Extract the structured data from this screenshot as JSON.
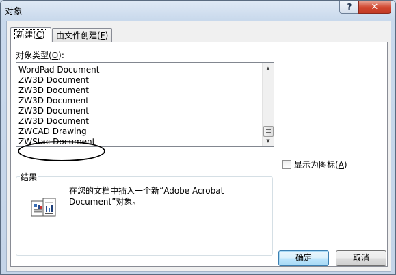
{
  "window": {
    "title": "对象",
    "help_label": "?",
    "close_label": "✕"
  },
  "tabs": [
    {
      "label": "新建(C)",
      "pre": "新建(",
      "key": "C",
      "post": ")",
      "active": true
    },
    {
      "label": "由文件创建(F)",
      "pre": "由文件创建(",
      "key": "F",
      "post": ")",
      "active": false
    }
  ],
  "object_type": {
    "label_pre": "对象类型(",
    "label_key": "O",
    "label_post": "):",
    "items": [
      "WordPad Document",
      "ZW3D Document",
      "ZW3D Document",
      "ZW3D Document",
      "ZW3D Document",
      "ZW3D Document",
      "ZWCAD Drawing",
      "ZWStac Document"
    ],
    "highlighted_item": "ZWCAD Drawing"
  },
  "display_as_icon": {
    "pre": "显示为图标(",
    "key": "A",
    "post": ")",
    "checked": false
  },
  "result": {
    "title": "结果",
    "line1": "在您的文档中插入一个新“Adobe Acrobat",
    "line2": "Document”对象。"
  },
  "buttons": {
    "ok": "确定",
    "cancel": "取消"
  },
  "icons": {
    "help": "help-icon",
    "close": "close-icon",
    "scroll_up": "scroll-up-arrow-icon",
    "scroll_down": "scroll-down-arrow-icon",
    "result": "object-document-icon"
  }
}
